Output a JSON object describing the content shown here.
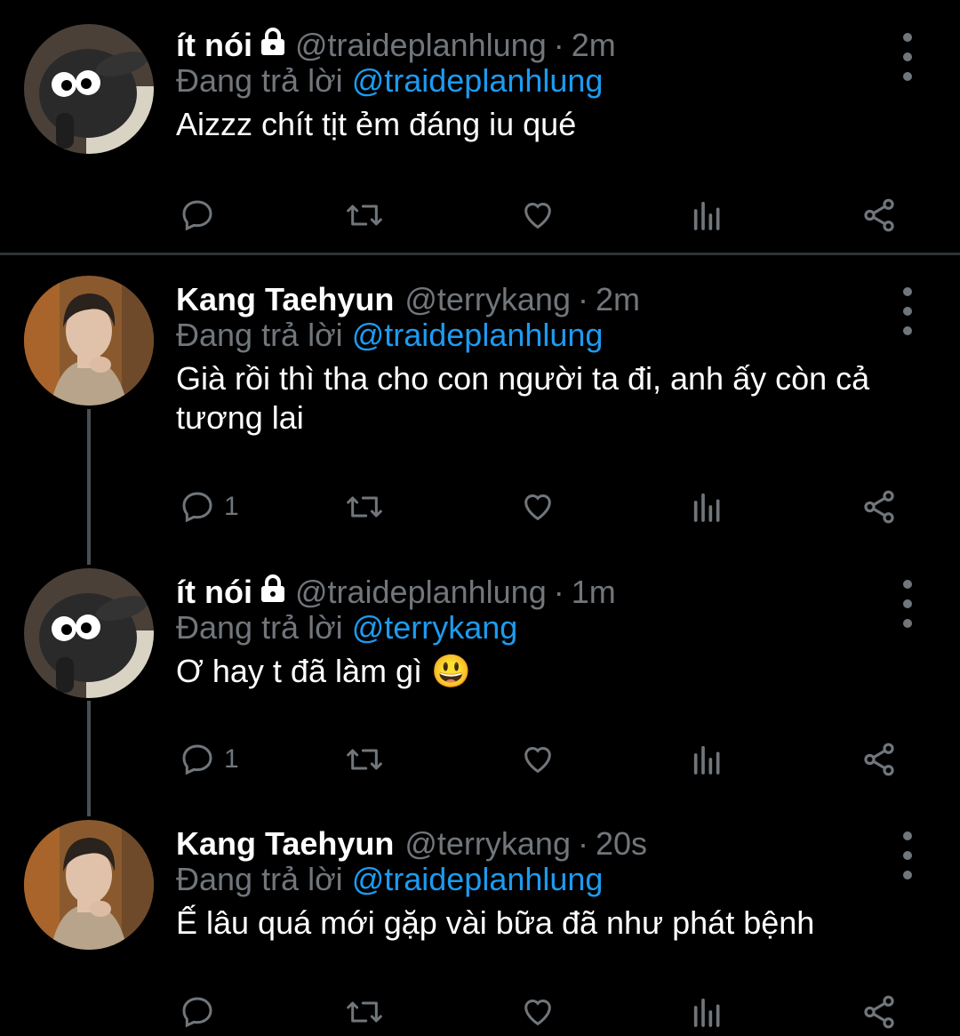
{
  "tweets": [
    {
      "name": "ít nói",
      "locked": true,
      "handle": "@traideplanhlung",
      "time": "2m",
      "reply_prefix": "Đang trả lời",
      "reply_to": "@traideplanhlung",
      "text": "Aizzz chít tịt ẻm đáng iu qué",
      "reply_count": "",
      "avatar": "sheep-avatar"
    },
    {
      "name": "Kang Taehyun",
      "locked": false,
      "handle": "@terrykang",
      "time": "2m",
      "reply_prefix": "Đang trả lời",
      "reply_to": "@traideplanhlung",
      "text": "Già rồi thì tha cho con người ta đi, anh ấy còn cả tương lai",
      "reply_count": "1",
      "avatar": "person-avatar"
    },
    {
      "name": "ít nói",
      "locked": true,
      "handle": "@traideplanhlung",
      "time": "1m",
      "reply_prefix": "Đang trả lời",
      "reply_to": "@terrykang",
      "text": "Ơ hay t đã làm gì 😃",
      "reply_count": "1",
      "avatar": "sheep-avatar"
    },
    {
      "name": "Kang Taehyun",
      "locked": false,
      "handle": "@terrykang",
      "time": "20s",
      "reply_prefix": "Đang trả lời",
      "reply_to": "@traideplanhlung",
      "text": "Ế lâu quá mới gặp vài bữa đã như phát bệnh",
      "reply_count": "",
      "avatar": "person-avatar"
    }
  ],
  "icons": {
    "reply": "comment-icon",
    "retweet": "retweet-icon",
    "like": "heart-icon",
    "views": "bar-chart-icon",
    "share": "share-icon",
    "more": "more-vertical-icon"
  },
  "colors": {
    "background": "#000000",
    "text": "#ffffff",
    "muted": "#71767b",
    "mention": "#1d9bf0",
    "divider": "#2f3336",
    "thread_line": "#4a4f54"
  }
}
